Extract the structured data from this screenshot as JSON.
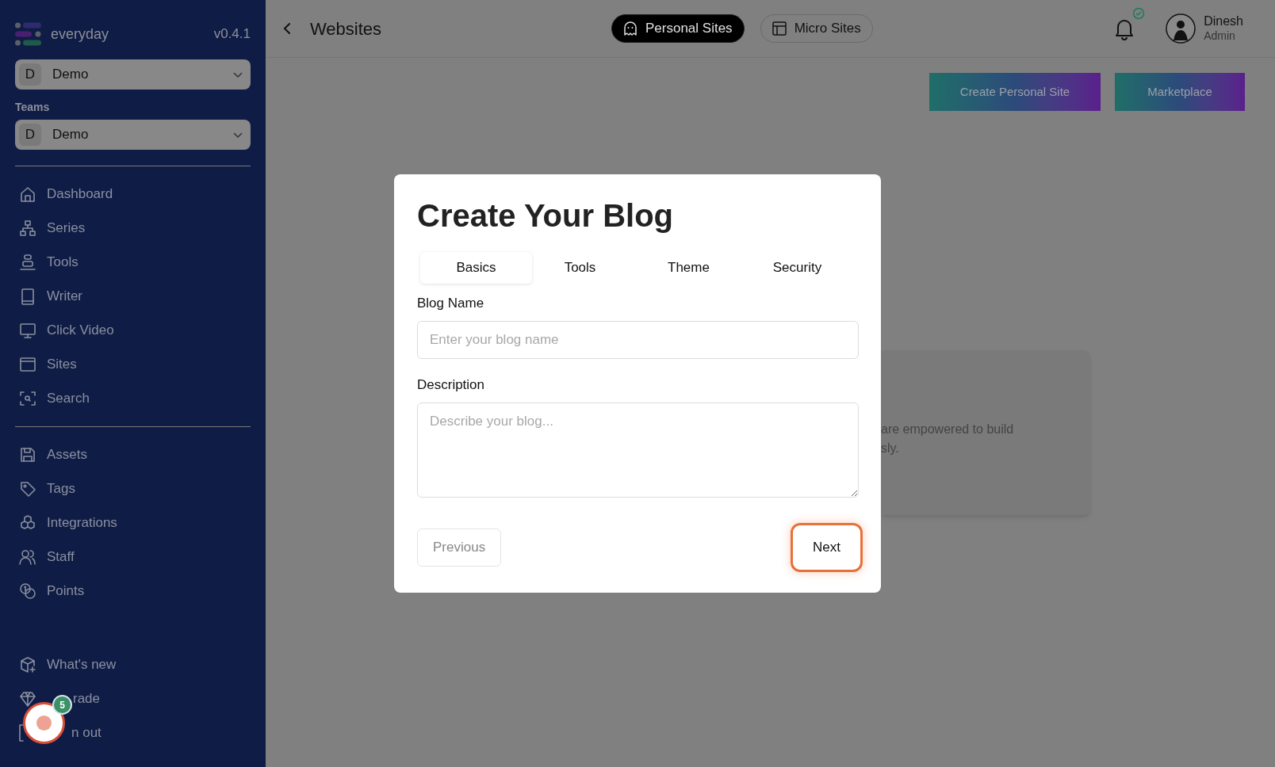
{
  "sidebar": {
    "logo": "everyday",
    "version": "v0.4.1",
    "workspace": {
      "initial": "D",
      "name": "Demo"
    },
    "teams_label": "Teams",
    "team": {
      "initial": "D",
      "name": "Demo"
    },
    "nav_groups": [
      [
        {
          "label": "Dashboard"
        },
        {
          "label": "Series"
        },
        {
          "label": "Tools"
        },
        {
          "label": "Writer"
        },
        {
          "label": "Click Video"
        },
        {
          "label": "Sites"
        },
        {
          "label": "Search"
        }
      ],
      [
        {
          "label": "Assets"
        },
        {
          "label": "Tags"
        },
        {
          "label": "Integrations"
        },
        {
          "label": "Staff"
        },
        {
          "label": "Points"
        }
      ],
      [
        {
          "label": "What's new"
        },
        {
          "label": "rade"
        },
        {
          "label": "n out"
        }
      ]
    ]
  },
  "header": {
    "title": "Websites",
    "tabs": [
      {
        "label": "Personal Sites",
        "selected": true
      },
      {
        "label": "Micro Sites",
        "selected": false
      }
    ],
    "user": {
      "name": "Dinesh",
      "role": "Admin"
    }
  },
  "actions": [
    "Create Personal Site",
    "Marketplace"
  ],
  "background_card": {
    "lines": [
      "are empowered to build",
      "sly."
    ]
  },
  "modal": {
    "title": "Create Your Blog",
    "tabs": [
      {
        "label": "Basics",
        "selected": true
      },
      {
        "label": "Tools",
        "selected": false
      },
      {
        "label": "Theme",
        "selected": false
      },
      {
        "label": "Security",
        "selected": false
      }
    ],
    "fields": [
      {
        "kind": "input",
        "label": "Blog Name",
        "placeholder": "Enter your blog name"
      },
      {
        "kind": "textarea",
        "label": "Description",
        "placeholder": "Describe your blog..."
      }
    ],
    "previous": "Previous",
    "next": "Next"
  },
  "help_button": {
    "badge": "5"
  }
}
